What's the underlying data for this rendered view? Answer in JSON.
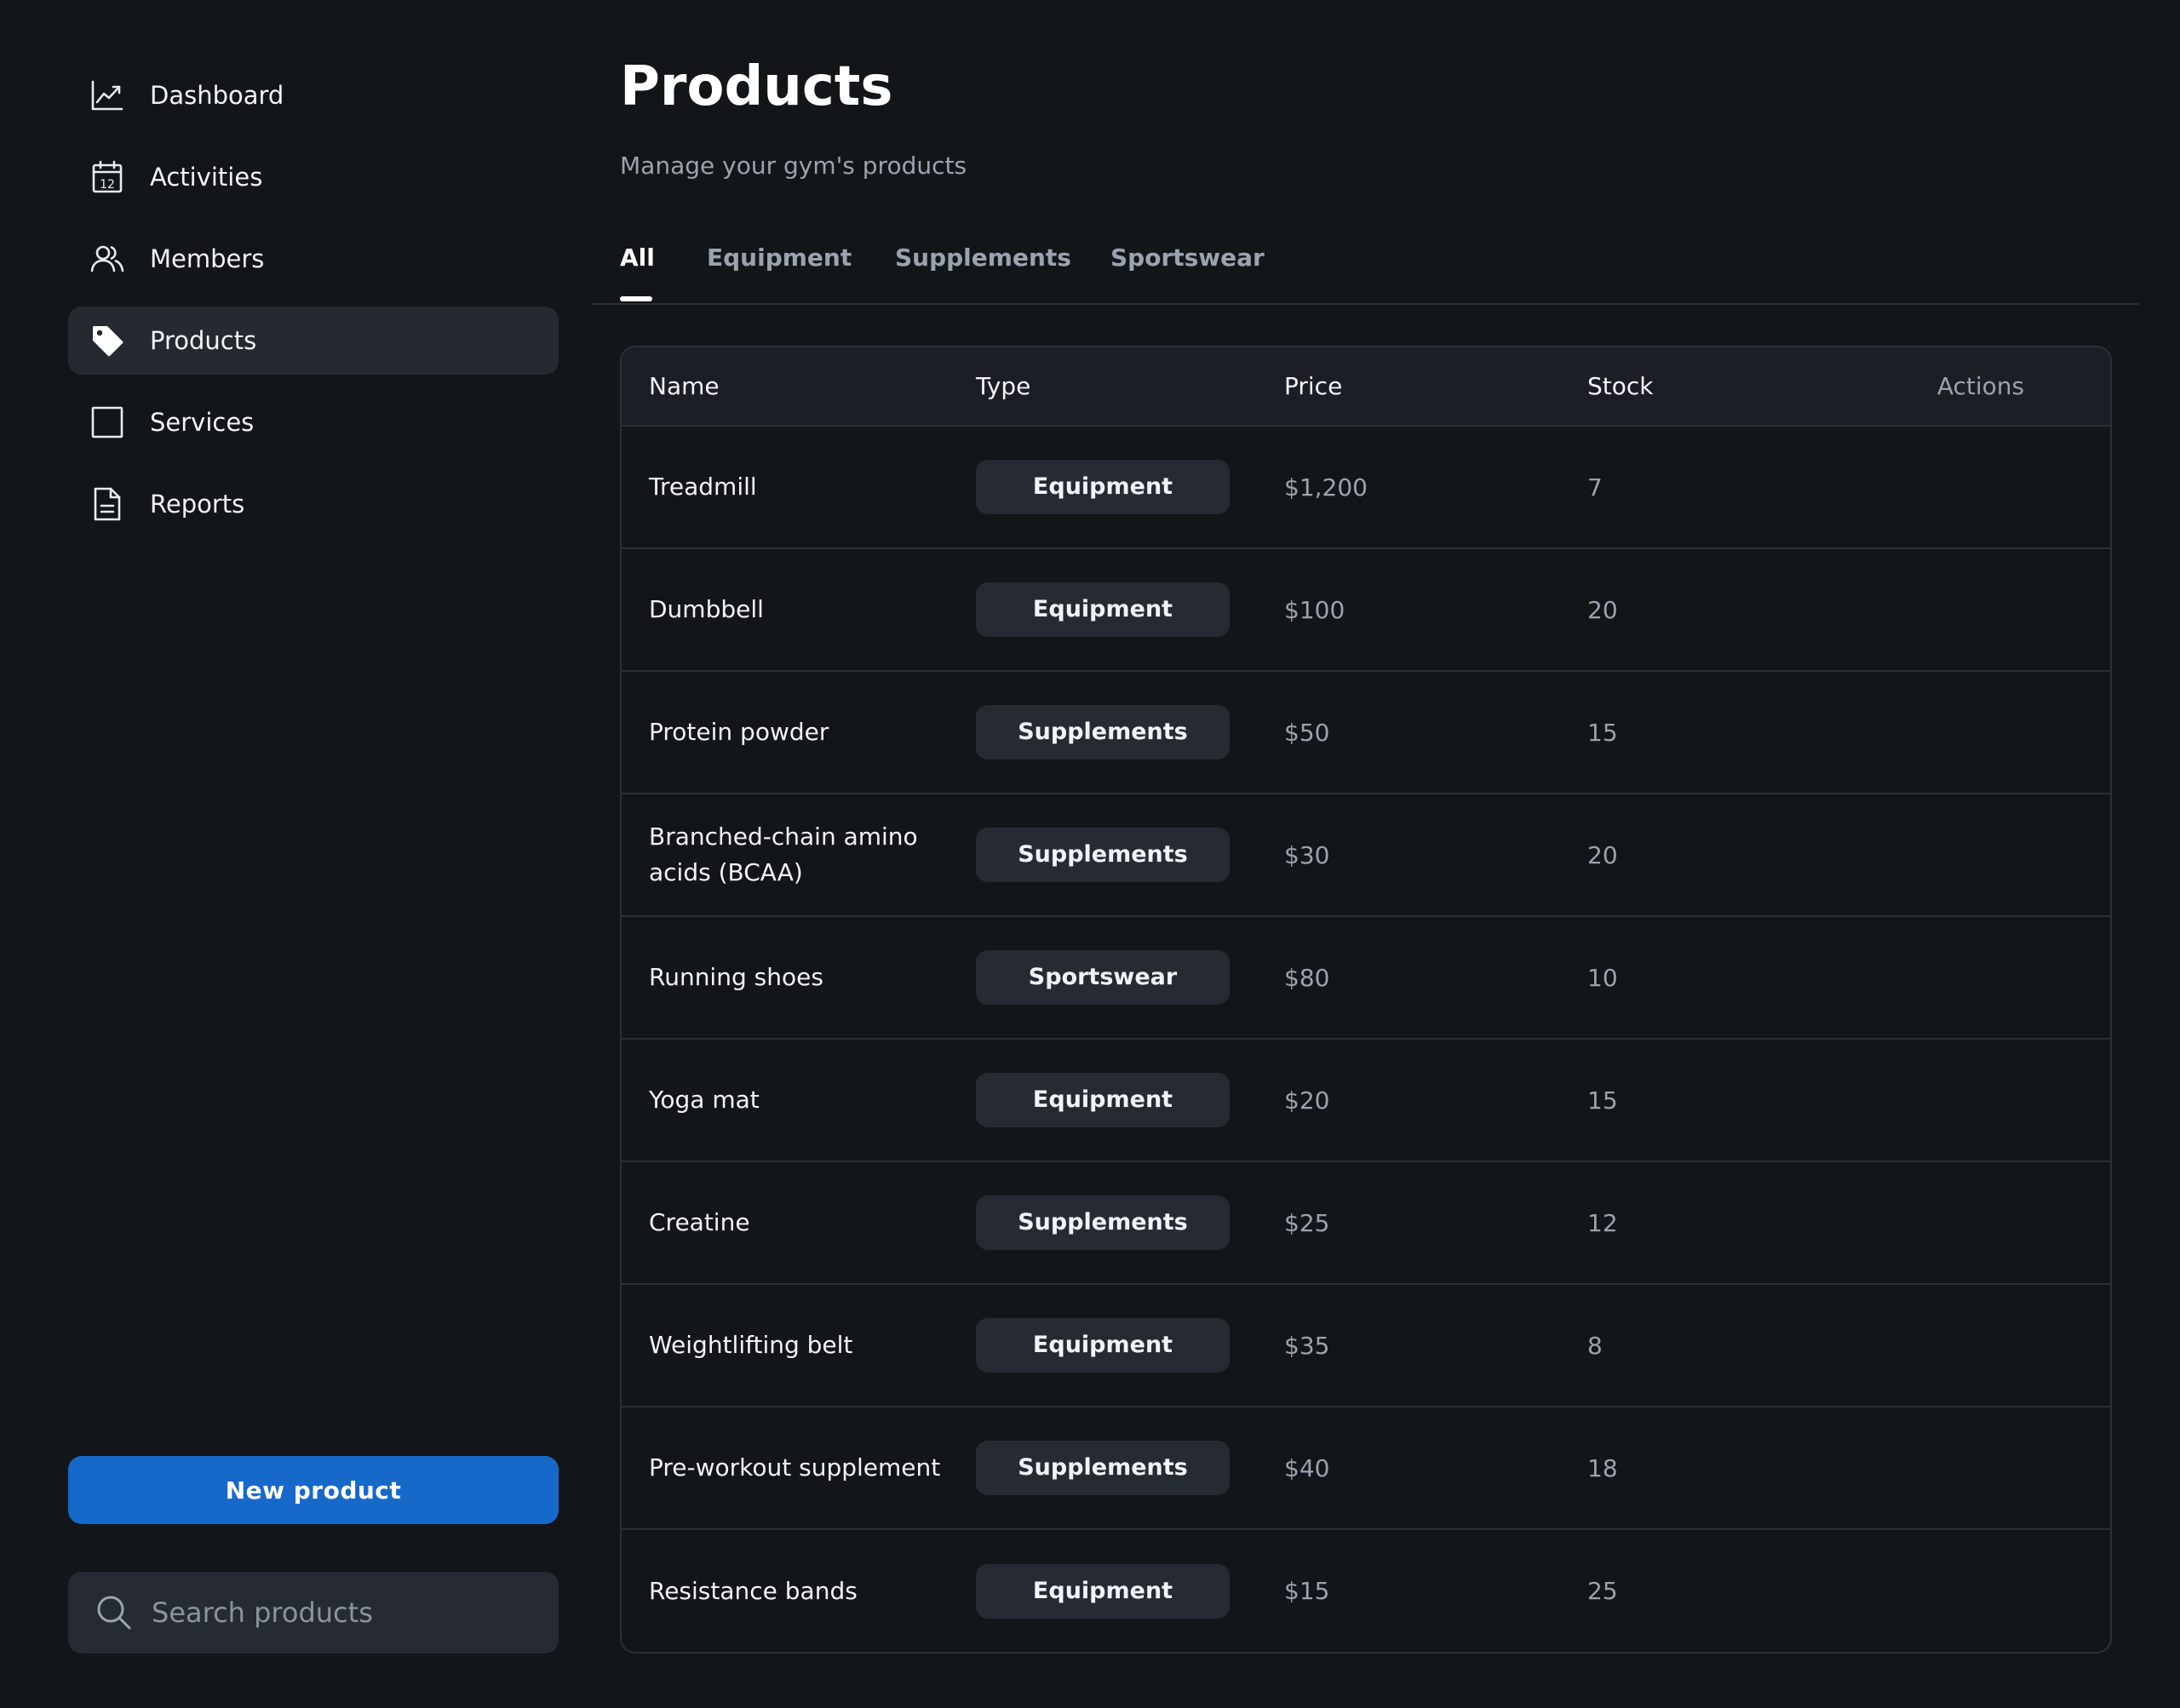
{
  "sidebar": {
    "nav": [
      {
        "label": "Dashboard",
        "icon": "chart-line-icon"
      },
      {
        "label": "Activities",
        "icon": "calendar-icon"
      },
      {
        "label": "Members",
        "icon": "users-icon"
      },
      {
        "label": "Products",
        "icon": "tag-icon",
        "active": true
      },
      {
        "label": "Services",
        "icon": "square-icon"
      },
      {
        "label": "Reports",
        "icon": "document-icon"
      }
    ],
    "calendar_day": "12",
    "new_product_label": "New product",
    "search_placeholder": "Search products"
  },
  "header": {
    "title": "Products",
    "subtitle": "Manage your gym's products"
  },
  "tabs": [
    {
      "label": "All",
      "active": true
    },
    {
      "label": "Equipment"
    },
    {
      "label": "Supplements"
    },
    {
      "label": "Sportswear"
    }
  ],
  "table": {
    "columns": [
      "Name",
      "Type",
      "Price",
      "Stock",
      "Actions"
    ],
    "rows": [
      {
        "name": "Treadmill",
        "type": "Equipment",
        "price": "$1,200",
        "stock": "7"
      },
      {
        "name": "Dumbbell",
        "type": "Equipment",
        "price": "$100",
        "stock": "20"
      },
      {
        "name": "Protein powder",
        "type": "Supplements",
        "price": "$50",
        "stock": "15"
      },
      {
        "name": "Branched-chain amino acids (BCAA)",
        "type": "Supplements",
        "price": "$30",
        "stock": "20"
      },
      {
        "name": "Running shoes",
        "type": "Sportswear",
        "price": "$80",
        "stock": "10"
      },
      {
        "name": "Yoga mat",
        "type": "Equipment",
        "price": "$20",
        "stock": "15"
      },
      {
        "name": "Creatine",
        "type": "Supplements",
        "price": "$25",
        "stock": "12"
      },
      {
        "name": "Weightlifting belt",
        "type": "Equipment",
        "price": "$35",
        "stock": "8"
      },
      {
        "name": "Pre-workout supplement",
        "type": "Supplements",
        "price": "$40",
        "stock": "18"
      },
      {
        "name": "Resistance bands",
        "type": "Equipment",
        "price": "$15",
        "stock": "25"
      }
    ]
  },
  "colors": {
    "background": "#121619",
    "accent": "#1769c9",
    "surface": "#262b33",
    "muted_text": "#9aa3ae"
  }
}
